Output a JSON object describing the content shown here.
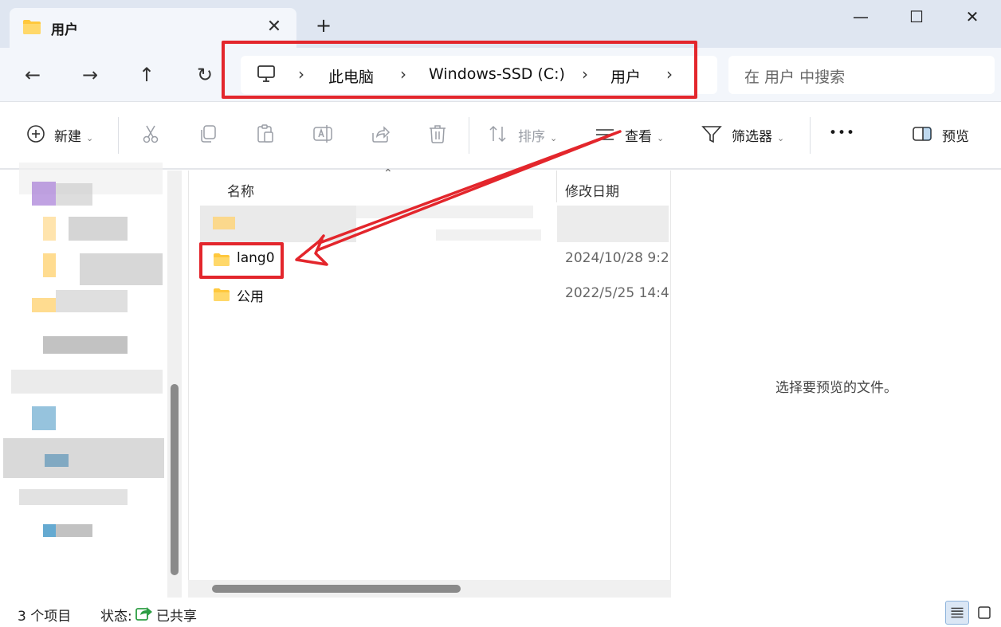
{
  "tab": {
    "title": "用户",
    "close": "✕",
    "new": "+"
  },
  "window": {
    "minimize": "—",
    "maximize": "☐",
    "close": "✕"
  },
  "nav": {
    "back": "←",
    "forward": "→",
    "up": "↑",
    "refresh": "↻"
  },
  "breadcrumb": {
    "items": [
      "此电脑",
      "Windows-SSD (C:)",
      "用户"
    ],
    "separator": "›"
  },
  "search": {
    "placeholder": "在 用户 中搜索"
  },
  "toolbar": {
    "new_label": "新建",
    "sort_label": "排序",
    "view_label": "查看",
    "filter_label": "筛选器",
    "more_label": "•••",
    "preview_label": "预览"
  },
  "columns": {
    "name": "名称",
    "modified": "修改日期"
  },
  "files": [
    {
      "name": "lang0",
      "modified": "2024/10/28 9:2"
    },
    {
      "name": "公用",
      "modified": "2022/5/25 14:4"
    }
  ],
  "preview": {
    "empty_text": "选择要预览的文件。"
  },
  "status": {
    "count": "3 个项目",
    "state_label": "状态:",
    "shared": "已共享"
  },
  "colors": {
    "accent": "#0067c0",
    "annotation_red": "#e3262c",
    "folder_yellow": "#ffcf4a"
  }
}
